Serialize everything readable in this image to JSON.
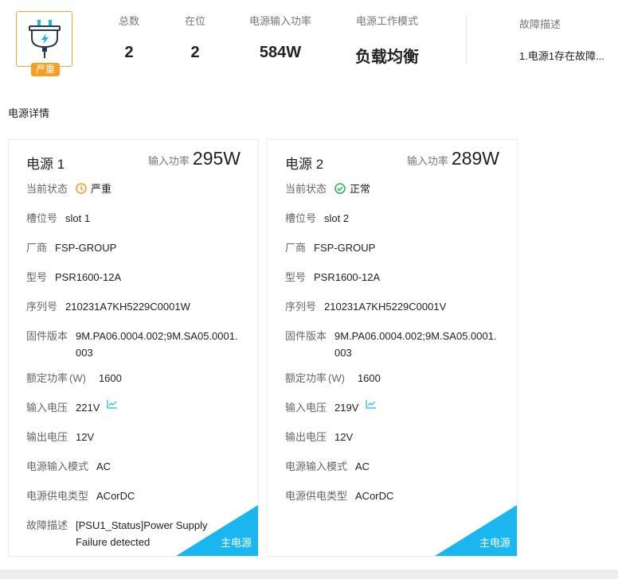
{
  "summary": {
    "logo_icon": "power-plug-icon",
    "severity_badge": "严重",
    "severity_color": "#f5a025",
    "total_label": "总数",
    "total_value": "2",
    "present_label": "在位",
    "present_value": "2",
    "input_power_label": "电源输入功率",
    "input_power_value": "584W",
    "work_mode_label": "电源工作模式",
    "work_mode_value": "负载均衡",
    "fault_label": "故障描述",
    "fault_value": "1.电源1存在故障..."
  },
  "section_title": "电源详情",
  "accent_color": "#1ab6f0",
  "cards": [
    {
      "name": "电源 1",
      "power_label": "输入功率",
      "power_value": "295W",
      "status_label": "当前状态",
      "status_value": "严重",
      "status_icon": "warning-clock-icon",
      "slot_label": "槽位号",
      "slot_value": "slot 1",
      "vendor_label": "厂商",
      "vendor_value": "FSP-GROUP",
      "model_label": "型号",
      "model_value": "PSR1600-12A",
      "serial_label": "序列号",
      "serial_value": "210231A7KH5229C0001W",
      "firmware_label": "固件版本",
      "firmware_value": "9M.PA06.0004.002;9M.SA05.0001.003",
      "rated_label": "额定功率",
      "rated_unit": "(W)",
      "rated_value": "1600",
      "in_volt_label": "输入电压",
      "in_volt_value": "221V",
      "out_volt_label": "输出电压",
      "out_volt_value": "12V",
      "in_mode_label": "电源输入模式",
      "in_mode_value": "AC",
      "supply_type_label": "电源供电类型",
      "supply_type_value": "ACorDC",
      "fault_label": "故障描述",
      "fault_value": "[PSU1_Status]Power Supply Failure detected",
      "corner_tag": "主电源"
    },
    {
      "name": "电源 2",
      "power_label": "输入功率",
      "power_value": "289W",
      "status_label": "当前状态",
      "status_value": "正常",
      "status_icon": "check-circle-icon",
      "slot_label": "槽位号",
      "slot_value": "slot 2",
      "vendor_label": "厂商",
      "vendor_value": "FSP-GROUP",
      "model_label": "型号",
      "model_value": "PSR1600-12A",
      "serial_label": "序列号",
      "serial_value": "210231A7KH5229C0001V",
      "firmware_label": "固件版本",
      "firmware_value": "9M.PA06.0004.002;9M.SA05.0001.003",
      "rated_label": "额定功率",
      "rated_unit": "(W)",
      "rated_value": "1600",
      "in_volt_label": "输入电压",
      "in_volt_value": "219V",
      "out_volt_label": "输出电压",
      "out_volt_value": "12V",
      "in_mode_label": "电源输入模式",
      "in_mode_value": "AC",
      "supply_type_label": "电源供电类型",
      "supply_type_value": "ACorDC",
      "corner_tag": "主电源"
    }
  ]
}
